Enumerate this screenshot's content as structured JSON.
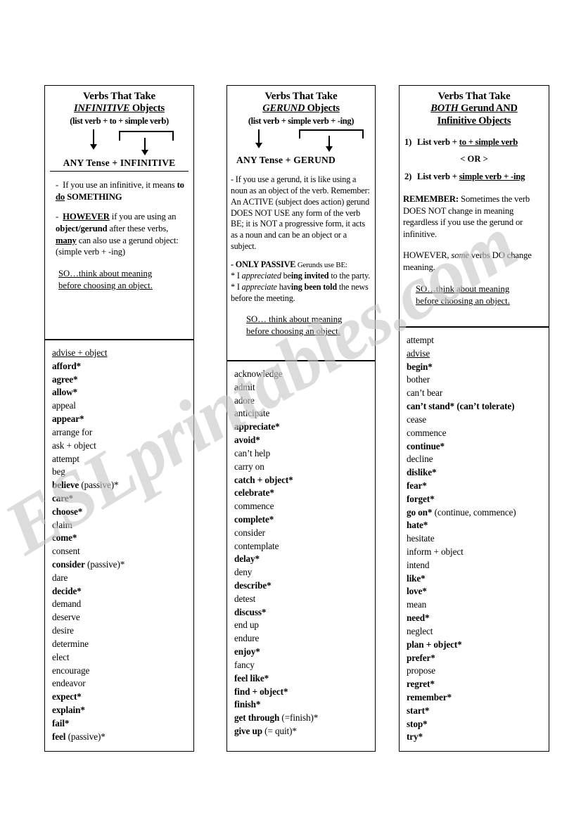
{
  "watermark": {
    "text": "ESLprintables.com"
  },
  "columns": [
    {
      "id": "infinitive",
      "header": {
        "title": "Verbs That Take",
        "subject_pre": "INFINITIVE",
        "subject_post": " Objects",
        "formula": "(list verb + to + simple verb)",
        "tense_line": "ANY Tense +  INFINITIVE",
        "paragraphs": [
          "-  If you use an infinitive, it means to do SOMETHING",
          "-  HOWEVER if you are using an object/gerund after these verbs, many can also use a gerund object: (simple verb + -ing)"
        ],
        "so_line_1": "SO…think about meaning",
        "so_line_2": "before choosing an object."
      },
      "verbs": [
        {
          "text": "advise + object",
          "style": "underline"
        },
        {
          "text": "afford*",
          "style": "bold"
        },
        {
          "text": "agree*",
          "style": "bold"
        },
        {
          "text": "allow*",
          "style": "bold"
        },
        {
          "text": "appeal",
          "style": "plain"
        },
        {
          "text": "appear*",
          "style": "bold"
        },
        {
          "text": "arrange for",
          "style": "plain"
        },
        {
          "text": "ask + object",
          "style": "plain"
        },
        {
          "text": "attempt",
          "style": "plain"
        },
        {
          "text": "beg",
          "style": "plain"
        },
        {
          "text": "believe",
          "suffix": " (passive)*",
          "style": "bold-partial"
        },
        {
          "text": "care*",
          "style": "bold"
        },
        {
          "text": "choose*",
          "style": "bold"
        },
        {
          "text": "claim",
          "style": "plain"
        },
        {
          "text": "come*",
          "style": "bold"
        },
        {
          "text": "consent",
          "style": "plain"
        },
        {
          "text": "consider",
          "suffix": " (passive)*",
          "style": "bold-partial"
        },
        {
          "text": "dare",
          "style": "plain"
        },
        {
          "text": "decide*",
          "style": "bold"
        },
        {
          "text": "demand",
          "style": "plain"
        },
        {
          "text": "deserve",
          "style": "plain"
        },
        {
          "text": "desire",
          "style": "plain"
        },
        {
          "text": "determine",
          "style": "plain"
        },
        {
          "text": "elect",
          "style": "plain"
        },
        {
          "text": "encourage",
          "style": "plain"
        },
        {
          "text": "endeavor",
          "style": "plain"
        },
        {
          "text": "expect*",
          "style": "bold"
        },
        {
          "text": "explain*",
          "style": "bold"
        },
        {
          "text": "fail*",
          "style": "bold"
        },
        {
          "text": "feel",
          "suffix": " (passive)*",
          "style": "bold-partial"
        }
      ]
    },
    {
      "id": "gerund",
      "header": {
        "title": "Verbs That Take",
        "subject_pre": "GERUND",
        "subject_post": " Objects",
        "formula": "(list verb + simple verb + -ing)",
        "tense_line": "ANY Tense +    GERUND",
        "paragraph_main": "-  If you use a gerund, it is like using a noun as an object of the verb. Remember: An ACTIVE (subject does action) gerund DOES NOT USE any form of the verb BE; it is NOT a progressive form, it acts as a noun and can be an object or a subject.",
        "passive_label": "- ONLY PASSIVE",
        "passive_rest": " Gerunds use BE:",
        "example_1_a": "* I ",
        "example_1_ital": "appreciated",
        "example_1_b": " be",
        "example_1_bold": "ing invited",
        "example_1_c": " to the party.",
        "example_2_a": "* I ",
        "example_2_ital": "appreciate",
        "example_2_b": " hav",
        "example_2_bold": "ing been told",
        "example_2_c": " the news before the meeting.",
        "so_line_1": "SO… think about meaning",
        "so_line_2": "before choosing an object."
      },
      "verbs": [
        {
          "text": "acknowledge",
          "style": "plain"
        },
        {
          "text": "admit",
          "style": "plain"
        },
        {
          "text": "adore",
          "style": "plain"
        },
        {
          "text": "anticipate",
          "style": "plain"
        },
        {
          "text": "appreciate*",
          "style": "bold"
        },
        {
          "text": "avoid*",
          "style": "bold"
        },
        {
          "text": "can’t help",
          "style": "plain"
        },
        {
          "text": "carry on",
          "style": "plain"
        },
        {
          "text": "catch + object*",
          "style": "bold"
        },
        {
          "text": "celebrate*",
          "style": "bold"
        },
        {
          "text": "commence",
          "style": "plain"
        },
        {
          "text": "complete*",
          "style": "bold"
        },
        {
          "text": "consider",
          "style": "plain"
        },
        {
          "text": "contemplate",
          "style": "plain"
        },
        {
          "text": "delay*",
          "style": "bold"
        },
        {
          "text": "deny",
          "style": "plain"
        },
        {
          "text": "describe*",
          "style": "bold"
        },
        {
          "text": "detest",
          "style": "plain"
        },
        {
          "text": "discuss*",
          "style": "bold"
        },
        {
          "text": "end up",
          "style": "plain"
        },
        {
          "text": "endure",
          "style": "plain"
        },
        {
          "text": "enjoy*",
          "style": "bold"
        },
        {
          "text": "fancy",
          "style": "plain"
        },
        {
          "text": "feel like*",
          "style": "bold"
        },
        {
          "text": "find + object*",
          "style": "bold"
        },
        {
          "text": "finish*",
          "style": "bold"
        },
        {
          "text": "get through",
          "suffix": " (=finish)*",
          "style": "bold-partial"
        },
        {
          "text": "give up",
          "suffix": " (= quit)*",
          "style": "bold-partial"
        }
      ]
    },
    {
      "id": "both",
      "header": {
        "title": "Verbs That Take",
        "subject_pre": "BOTH",
        "subject_post": " Gerund AND",
        "subject_line3": "Infinitive Objects",
        "rule_1_index": "1)",
        "rule_1_pre": "List verb + ",
        "rule_1_ul": "to + simple verb",
        "or_text": "< OR >",
        "rule_2_index": "2)",
        "rule_2_pre": "List verb + ",
        "rule_2_ul": "simple verb + -ing",
        "remember_label": "REMEMBER:",
        "remember_rest": " Sometimes the verb DOES NOT change in meaning regardless if you use the gerund or infinitive.",
        "however_a": "HOWEVER, ",
        "however_ital": "some",
        "however_b": " verbs DO change meaning.",
        "so_line_1": "SO…think about meaning",
        "so_line_2": "before choosing an object."
      },
      "verbs": [
        {
          "text": "attempt",
          "style": "plain"
        },
        {
          "text": "advise",
          "style": "underline"
        },
        {
          "text": "begin*",
          "style": "bold"
        },
        {
          "text": "bother",
          "style": "plain"
        },
        {
          "text": "can’t bear",
          "style": "plain"
        },
        {
          "text": "can’t stand* (can’t tolerate)",
          "style": "bold"
        },
        {
          "text": "cease",
          "style": "plain"
        },
        {
          "text": "commence",
          "style": "plain"
        },
        {
          "text": "continue*",
          "style": "bold"
        },
        {
          "text": "decline",
          "style": "plain"
        },
        {
          "text": "dislike*",
          "style": "bold"
        },
        {
          "text": "fear*",
          "style": "bold"
        },
        {
          "text": "forget*",
          "style": "bold"
        },
        {
          "text": "go on*",
          "suffix": " (continue, commence)",
          "style": "bold-partial"
        },
        {
          "text": "hate*",
          "style": "bold"
        },
        {
          "text": "hesitate",
          "style": "plain"
        },
        {
          "text": "inform + object",
          "style": "plain"
        },
        {
          "text": "intend",
          "style": "plain"
        },
        {
          "text": "like*",
          "style": "bold"
        },
        {
          "text": "love*",
          "style": "bold"
        },
        {
          "text": "mean",
          "style": "plain"
        },
        {
          "text": "need*",
          "style": "bold"
        },
        {
          "text": "neglect",
          "style": "plain"
        },
        {
          "text": "plan + object*",
          "style": "bold"
        },
        {
          "text": "prefer*",
          "style": "bold"
        },
        {
          "text": "propose",
          "style": "plain"
        },
        {
          "text": "regret*",
          "style": "bold"
        },
        {
          "text": "remember*",
          "style": "bold"
        },
        {
          "text": "start*",
          "style": "bold"
        },
        {
          "text": "stop*",
          "style": "bold"
        },
        {
          "text": "try*",
          "style": "bold"
        }
      ]
    }
  ]
}
